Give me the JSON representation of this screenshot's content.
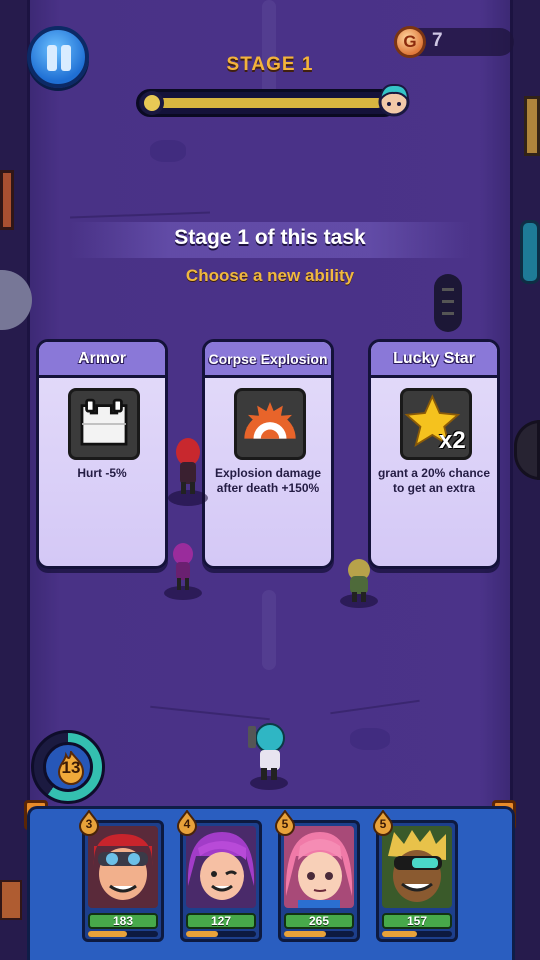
{
  "hud": {
    "stage_label": "STAGE 1",
    "coins": "7",
    "coin_icon": "coin-g-icon",
    "coin_letter": "G",
    "stage_progress": 0.02
  },
  "overlay": {
    "title": "Stage 1 of this task",
    "subtitle": "Choose a new ability"
  },
  "abilities": [
    {
      "name": "Armor",
      "description": "Hurt -5%",
      "icon": "armor-vest-icon"
    },
    {
      "name": "Corpse Explosion",
      "description": "Explosion damage after death +150%",
      "icon": "explosion-icon"
    },
    {
      "name": "Lucky Star",
      "description": "grant a 20% chance to get an extra",
      "icon": "star-x2-icon",
      "badge": "x2"
    }
  ],
  "player": {
    "level": "13",
    "level_progress": 0.6
  },
  "heroes": [
    {
      "level": "3",
      "hp": "183",
      "xp_fraction": 0.55,
      "portrait": "red-hair-goggles-brawler"
    },
    {
      "level": "4",
      "hp": "127",
      "xp_fraction": 0.45,
      "portrait": "purple-hair-brawler"
    },
    {
      "level": "5",
      "hp": "265",
      "xp_fraction": 0.6,
      "portrait": "pink-hair-brawler"
    },
    {
      "level": "5",
      "hp": "157",
      "xp_fraction": 0.5,
      "portrait": "green-goggles-brawler"
    }
  ],
  "colors": {
    "accent_gold": "#f0b840",
    "card_header": "#8a78d8",
    "panel_blue": "#2a5ec0",
    "hp_green": "#47a94a"
  }
}
